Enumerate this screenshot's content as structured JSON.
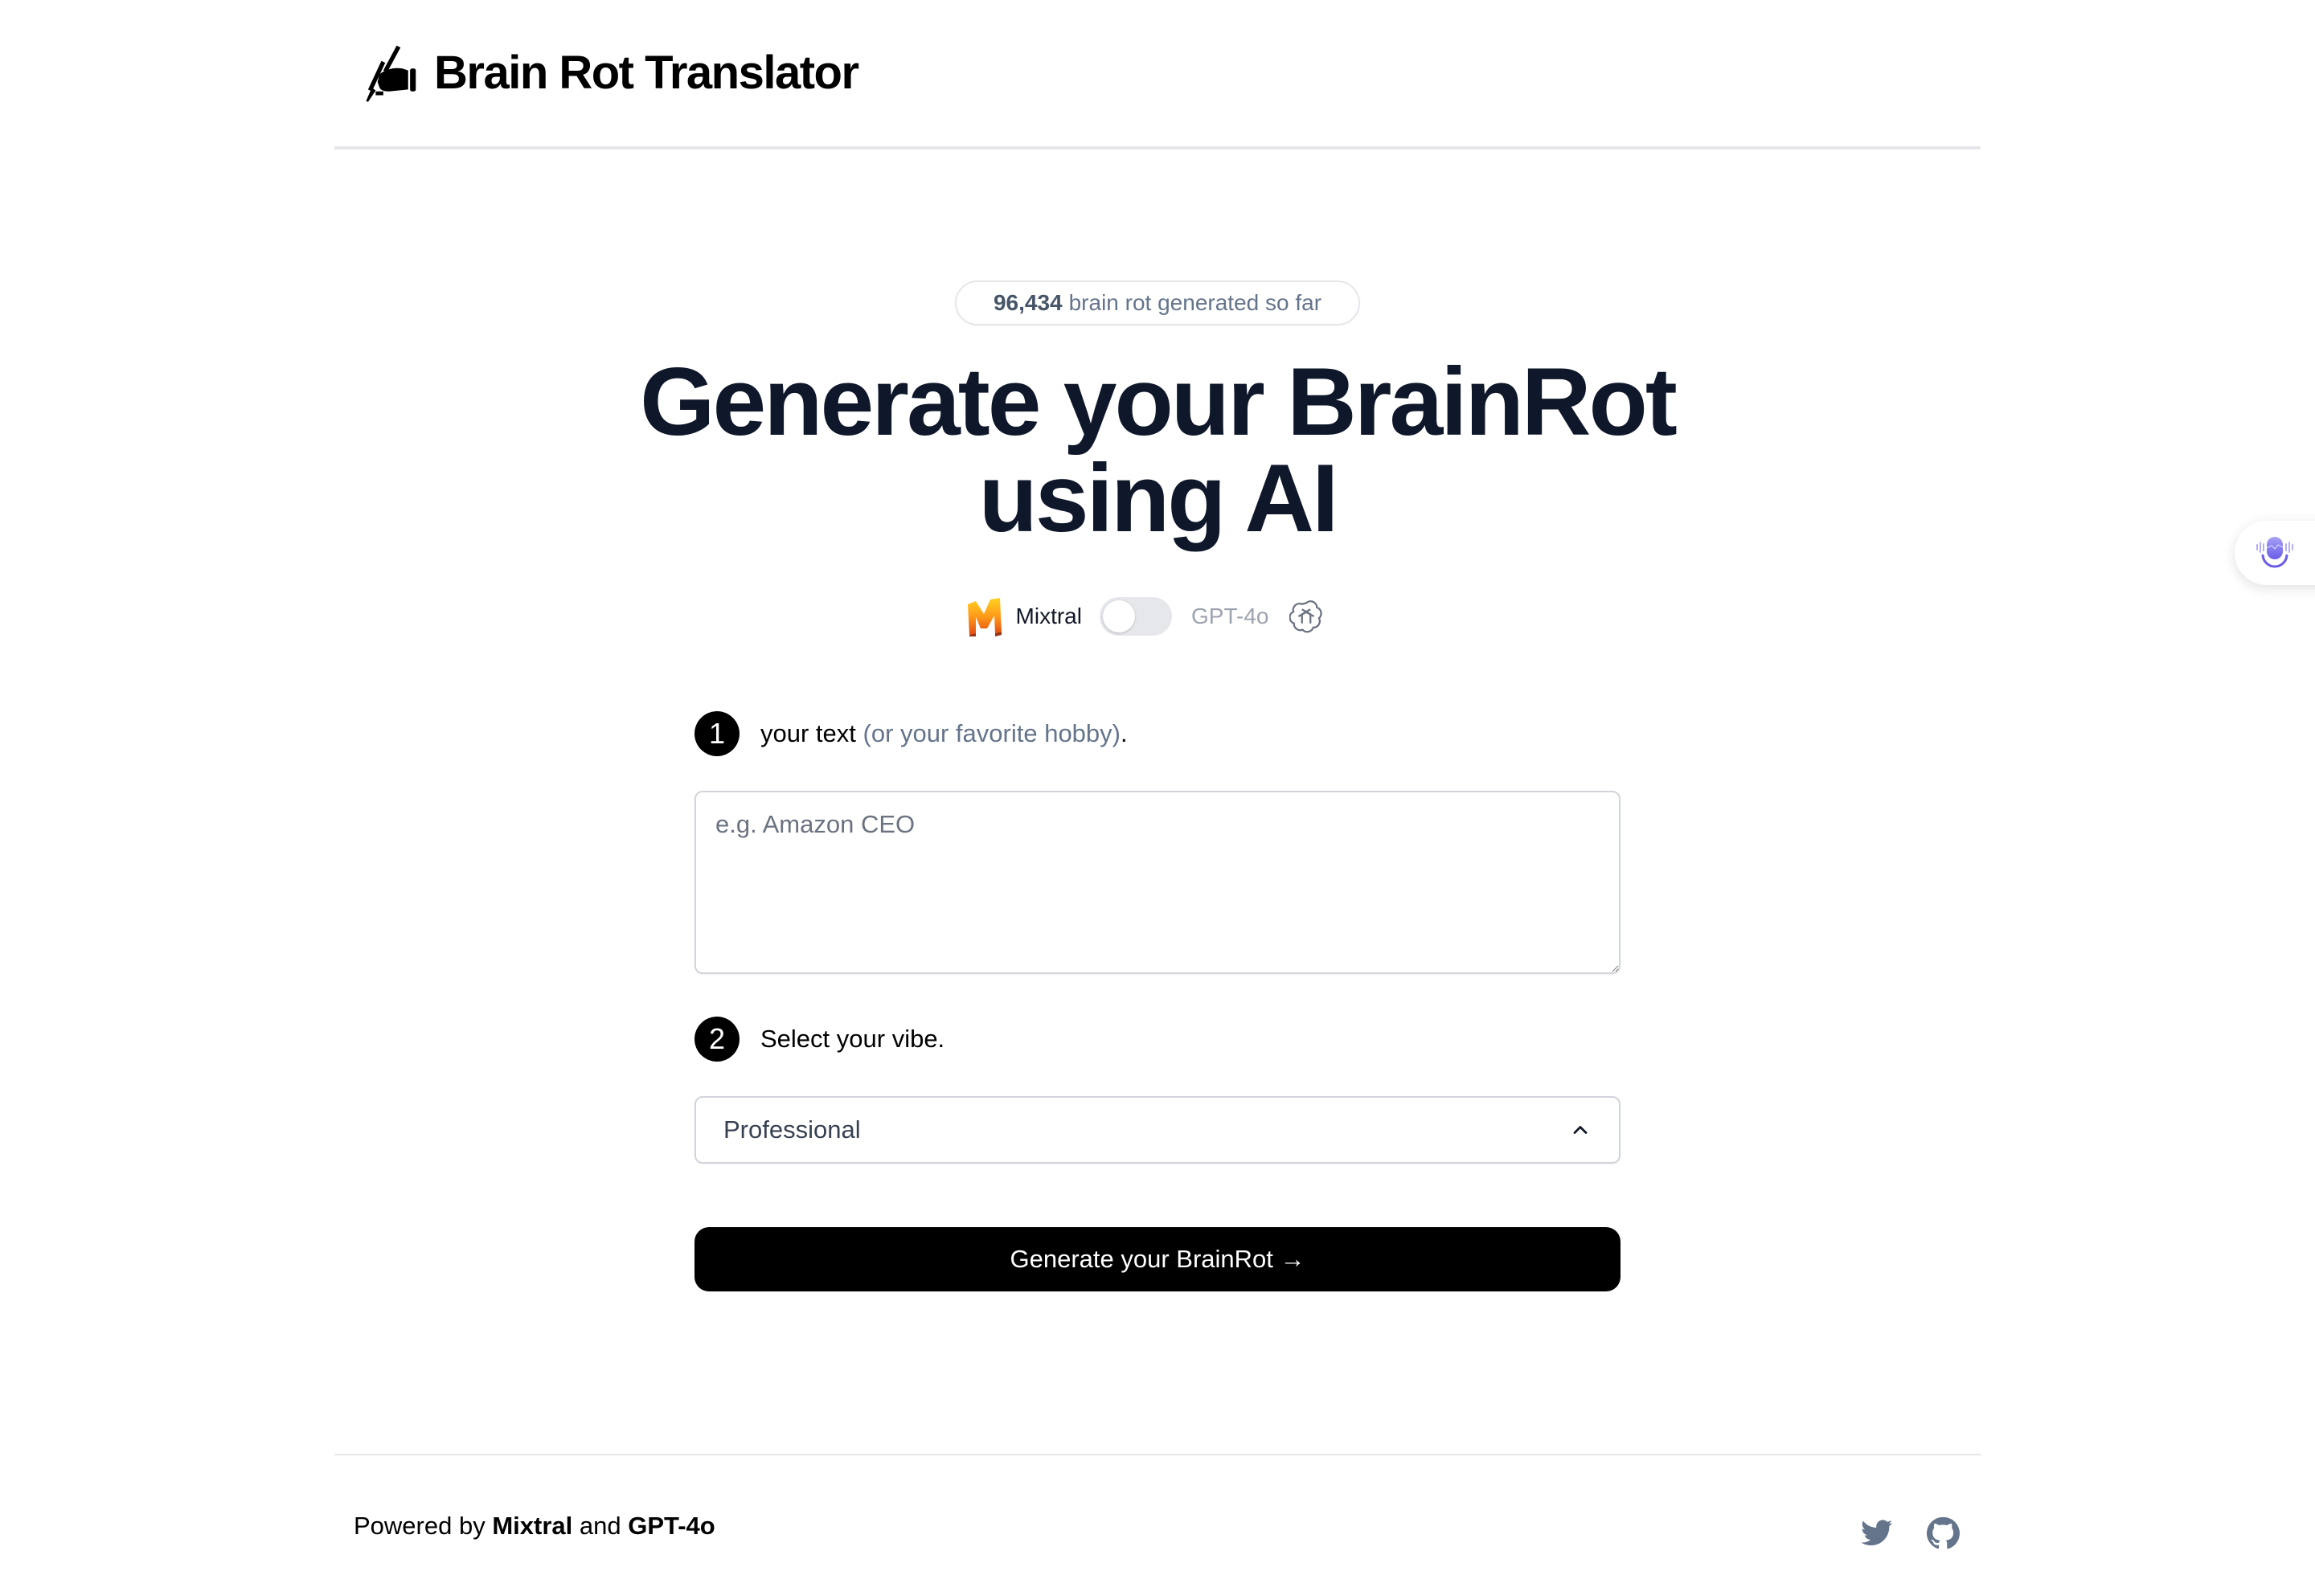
{
  "header": {
    "logo_icon": "writing-hand-icon",
    "title": "Brain Rot Translator"
  },
  "counter": {
    "count": "96,434",
    "suffix": "brain rot generated so far"
  },
  "hero": {
    "line1": "Generate your BrainRot",
    "line2": "using AI"
  },
  "model_toggle": {
    "left_icon": "mistral-logo-icon",
    "left_label": "Mixtral",
    "right_label": "GPT-4o",
    "right_icon": "openai-icon",
    "selected": "Mixtral",
    "checked": false
  },
  "step1": {
    "number": "1",
    "label": "your text",
    "hint": "(or your favorite hobby)",
    "punct": ".",
    "textarea": {
      "value": "",
      "placeholder": "e.g. Amazon CEO"
    }
  },
  "step2": {
    "number": "2",
    "label": "Select your vibe.",
    "select": {
      "value": "Professional",
      "icon": "chevron-up-icon"
    }
  },
  "generate_button": {
    "label": "Generate your BrainRot →"
  },
  "footer": {
    "prefix": "Powered by ",
    "model1": "Mixtral",
    "middle": " and ",
    "model2": "GPT-4o",
    "links": [
      {
        "icon": "twitter-icon",
        "color": "#64748b"
      },
      {
        "icon": "github-icon",
        "color": "#64748b"
      }
    ]
  },
  "floating_widget": {
    "icon": "voice-assistant-icon",
    "accent": "#7c6cf0"
  },
  "colors": {
    "heading": "#0f172a",
    "muted": "#64748b",
    "button_bg": "#000000",
    "border": "#e5e7eb"
  }
}
